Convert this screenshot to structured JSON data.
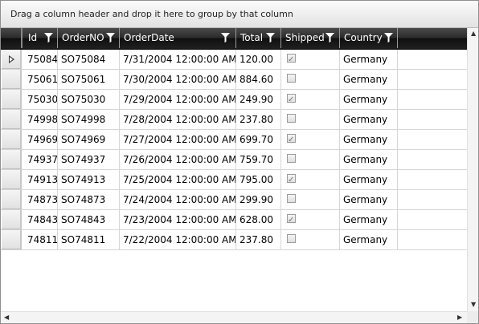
{
  "group_panel": {
    "hint": "Drag a column header and drop it here to group by that column"
  },
  "columns": [
    {
      "key": "id",
      "label": "Id"
    },
    {
      "key": "order_no",
      "label": "OrderNO"
    },
    {
      "key": "order_date",
      "label": "OrderDate"
    },
    {
      "key": "total",
      "label": "Total"
    },
    {
      "key": "shipped",
      "label": "Shipped"
    },
    {
      "key": "country",
      "label": "Country"
    }
  ],
  "rows": [
    {
      "id": "75084",
      "order_no": "SO75084",
      "order_date": "7/31/2004 12:00:00 AM",
      "total": "120.00",
      "shipped": true,
      "country": "Germany",
      "current": true
    },
    {
      "id": "75061",
      "order_no": "SO75061",
      "order_date": "7/30/2004 12:00:00 AM",
      "total": "884.60",
      "shipped": false,
      "country": "Germany"
    },
    {
      "id": "75030",
      "order_no": "SO75030",
      "order_date": "7/29/2004 12:00:00 AM",
      "total": "249.90",
      "shipped": true,
      "country": "Germany"
    },
    {
      "id": "74998",
      "order_no": "SO74998",
      "order_date": "7/28/2004 12:00:00 AM",
      "total": "237.80",
      "shipped": false,
      "country": "Germany"
    },
    {
      "id": "74969",
      "order_no": "SO74969",
      "order_date": "7/27/2004 12:00:00 AM",
      "total": "699.70",
      "shipped": true,
      "country": "Germany"
    },
    {
      "id": "74937",
      "order_no": "SO74937",
      "order_date": "7/26/2004 12:00:00 AM",
      "total": "759.70",
      "shipped": false,
      "country": "Germany"
    },
    {
      "id": "74913",
      "order_no": "SO74913",
      "order_date": "7/25/2004 12:00:00 AM",
      "total": "795.00",
      "shipped": true,
      "country": "Germany"
    },
    {
      "id": "74873",
      "order_no": "SO74873",
      "order_date": "7/24/2004 12:00:00 AM",
      "total": "299.90",
      "shipped": false,
      "country": "Germany"
    },
    {
      "id": "74843",
      "order_no": "SO74843",
      "order_date": "7/23/2004 12:00:00 AM",
      "total": "628.00",
      "shipped": true,
      "country": "Germany"
    },
    {
      "id": "74811",
      "order_no": "SO74811",
      "order_date": "7/22/2004 12:00:00 AM",
      "total": "237.80",
      "shipped": false,
      "country": "Germany"
    }
  ],
  "icons": {
    "filter": "filter-icon",
    "current_row": "current-row-indicator-icon",
    "scroll_up": "scroll-up-arrow-icon",
    "scroll_down": "scroll-down-arrow-icon",
    "scroll_left": "scroll-left-arrow-icon",
    "scroll_right": "scroll-right-arrow-icon"
  },
  "colors": {
    "header_bg": "#1f1f1f",
    "header_text": "#ffffff",
    "grid_line": "#d6d6d6",
    "group_panel_bg": "#e8e8e8"
  }
}
